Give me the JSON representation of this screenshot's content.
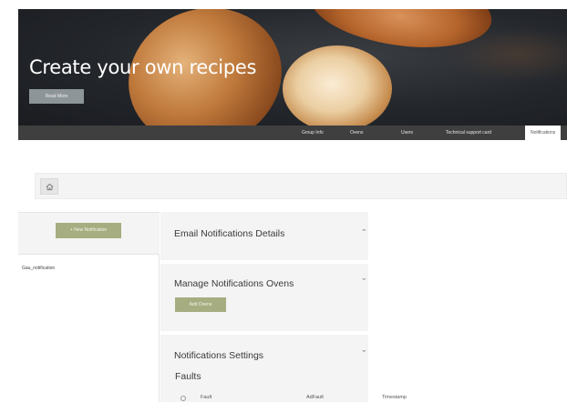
{
  "hero": {
    "title": "Create your own recipes",
    "button_label": "Read More"
  },
  "nav": {
    "items": [
      {
        "label": "Group Info"
      },
      {
        "label": "Ovens"
      },
      {
        "label": "Users"
      },
      {
        "label": "Technical support card"
      },
      {
        "label": "Notifications"
      }
    ],
    "active_index": 4
  },
  "breadcrumb": {
    "icon": "home-icon"
  },
  "sidebar": {
    "add_button_label": "+ New Notification",
    "items": [
      {
        "label": "Gau_notification"
      }
    ]
  },
  "main": {
    "sections": [
      {
        "title": "Email Notifications Details",
        "chevron": "chevron-up-icon"
      },
      {
        "title": "Manage Notifications Ovens",
        "chevron": "chevron-down-icon",
        "button_label": "Add Ovens"
      },
      {
        "title": "Notifications Settings",
        "chevron": "chevron-down-icon"
      }
    ],
    "faults_label": "Faults",
    "columns": [
      "Fault",
      "AdFault",
      "Timestamp"
    ]
  },
  "colors": {
    "accent_green": "#a6ad80",
    "nav_bg": "#3f3f3f",
    "hero_button": "#8e9599"
  }
}
